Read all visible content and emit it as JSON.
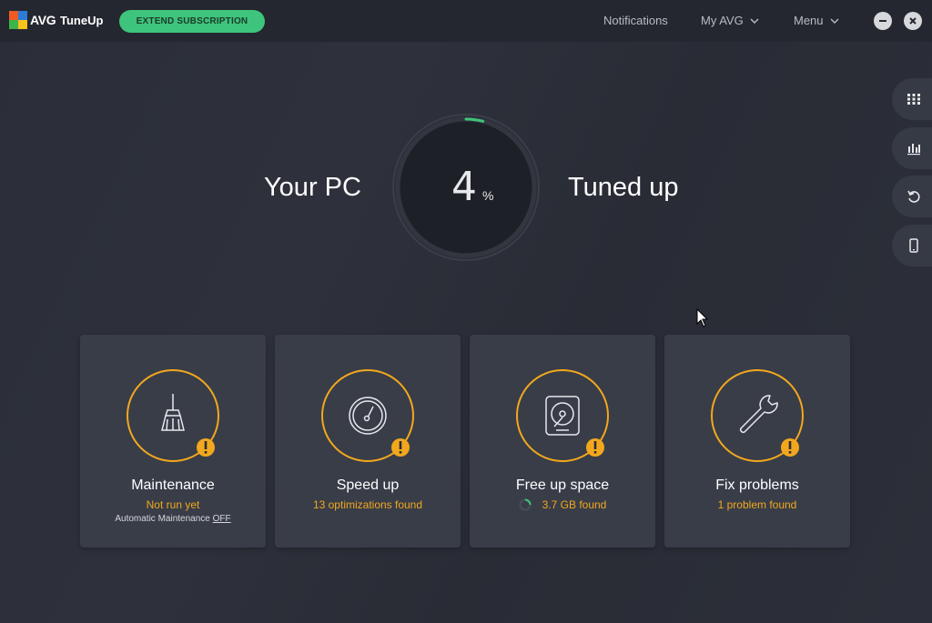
{
  "window": {
    "brand": "AVG",
    "product": "TuneUp",
    "extend_label": "EXTEND SUBSCRIPTION",
    "nav": {
      "notifications": "Notifications",
      "my_avg": "My AVG",
      "menu": "Menu"
    }
  },
  "side_tabs": [
    {
      "icon": "grid-icon"
    },
    {
      "icon": "bar-chart-icon"
    },
    {
      "icon": "undo-icon"
    },
    {
      "icon": "mobile-icon"
    }
  ],
  "hero": {
    "left_text": "Your PC",
    "right_text": "Tuned up",
    "value": "4",
    "unit": "%",
    "progress_fraction": 0.04
  },
  "cards": [
    {
      "title": "Maintenance",
      "status": "Not run yet",
      "sub_prefix": "Automatic Maintenance",
      "sub_link": "OFF",
      "icon": "broom-icon"
    },
    {
      "title": "Speed up",
      "status": "13 optimizations found",
      "icon": "speedometer-icon"
    },
    {
      "title": "Free up space",
      "status": "3.7 GB found",
      "icon": "hard-drive-icon"
    },
    {
      "title": "Fix problems",
      "status": "1 problem found",
      "icon": "wrench-icon"
    }
  ],
  "colors": {
    "accent_green": "#3ec47c",
    "warning_orange": "#f2a81d",
    "background": "#2a2d37",
    "card": "#393d48"
  }
}
